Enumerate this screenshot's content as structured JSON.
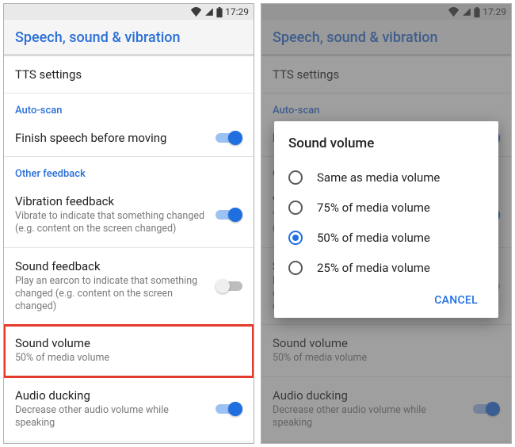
{
  "status": {
    "time": "17:29"
  },
  "page_title": "Speech, sound & vibration",
  "rows": {
    "tts": {
      "title": "TTS settings"
    },
    "autoscan_header": "Auto-scan",
    "finish_speech": {
      "title": "Finish speech before moving",
      "on": true
    },
    "other_header": "Other feedback",
    "vibration": {
      "title": "Vibration feedback",
      "sub": "Vibrate to indicate that something changed (e.g. content on the screen changed)",
      "on": true
    },
    "sound_feedback": {
      "title": "Sound feedback",
      "sub": "Play an earcon to indicate that something changed (e.g. content on the screen changed)",
      "on": false
    },
    "sound_volume": {
      "title": "Sound volume",
      "sub": "50% of media volume"
    },
    "audio_ducking": {
      "title": "Audio ducking",
      "sub": "Decrease other audio volume while speaking",
      "on": true
    }
  },
  "dialog": {
    "title": "Sound volume",
    "options": [
      "Same as media volume",
      "75% of media volume",
      "50% of media volume",
      "25% of media volume"
    ],
    "selected_index": 2,
    "cancel": "CANCEL"
  }
}
